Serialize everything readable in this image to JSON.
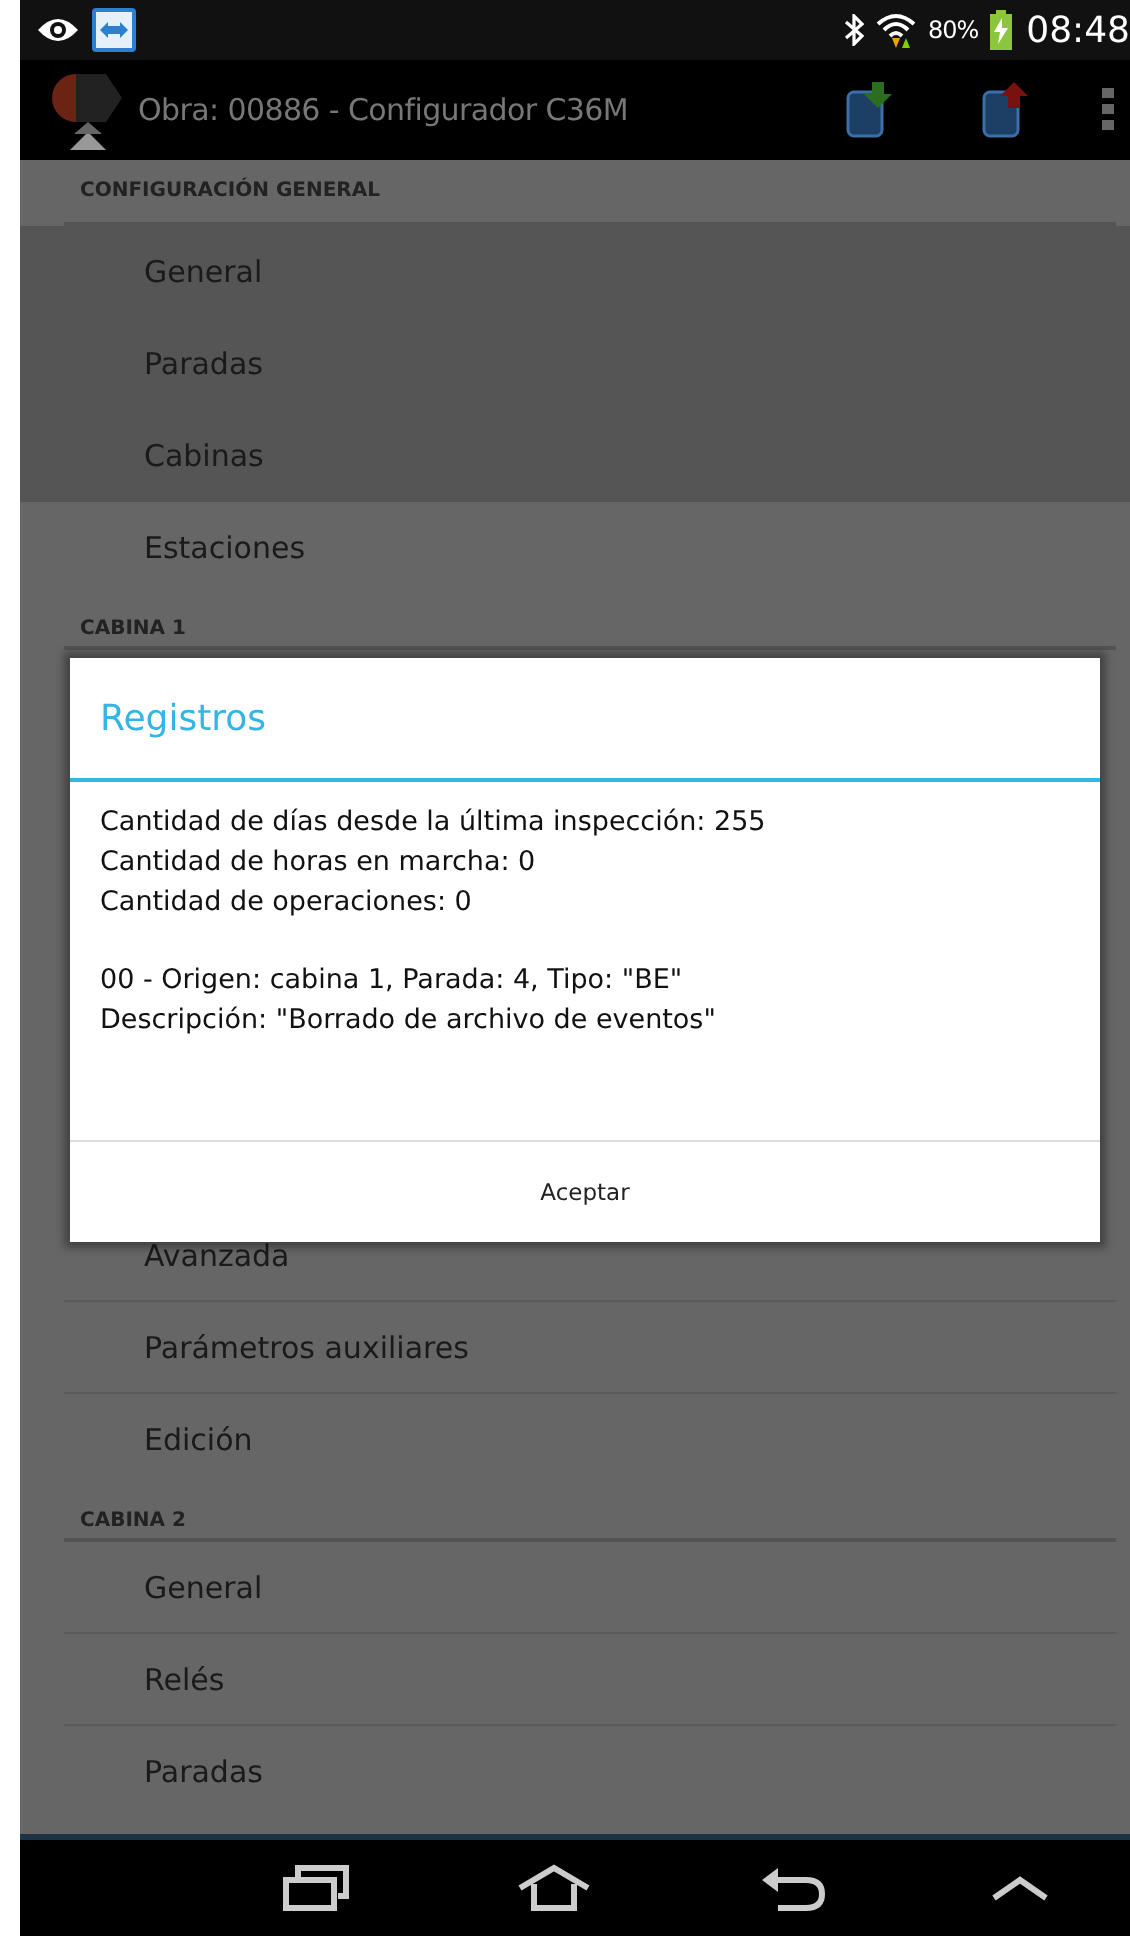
{
  "status_bar": {
    "battery": "80%",
    "time": "08:48"
  },
  "app_bar": {
    "title": "Obra: 00886 - Configurador C36M"
  },
  "sections": [
    {
      "title": "CONFIGURACIÓN GENERAL",
      "items": [
        {
          "label": "General"
        },
        {
          "label": "Paradas"
        },
        {
          "label": "Cabinas"
        },
        {
          "label": "Estaciones"
        }
      ]
    },
    {
      "title": "CABINA 1",
      "items": [
        {
          "label": "Avanzada"
        },
        {
          "label": "Parámetros auxiliares"
        },
        {
          "label": "Edición"
        }
      ]
    },
    {
      "title": "CABINA 2",
      "items": [
        {
          "label": "General"
        },
        {
          "label": "Relés"
        },
        {
          "label": "Paradas"
        }
      ]
    }
  ],
  "dialog": {
    "title": "Registros",
    "paragraphs": [
      [
        "Cantidad de días desde la última inspección: 255",
        "Cantidad de horas en marcha: 0",
        "Cantidad de operaciones: 0"
      ],
      [
        "00 - Origen: cabina 1, Parada: 4, Tipo: \"BE\"",
        "Descripción: \"Borrado de archivo de eventos\""
      ]
    ],
    "button": "Aceptar"
  }
}
